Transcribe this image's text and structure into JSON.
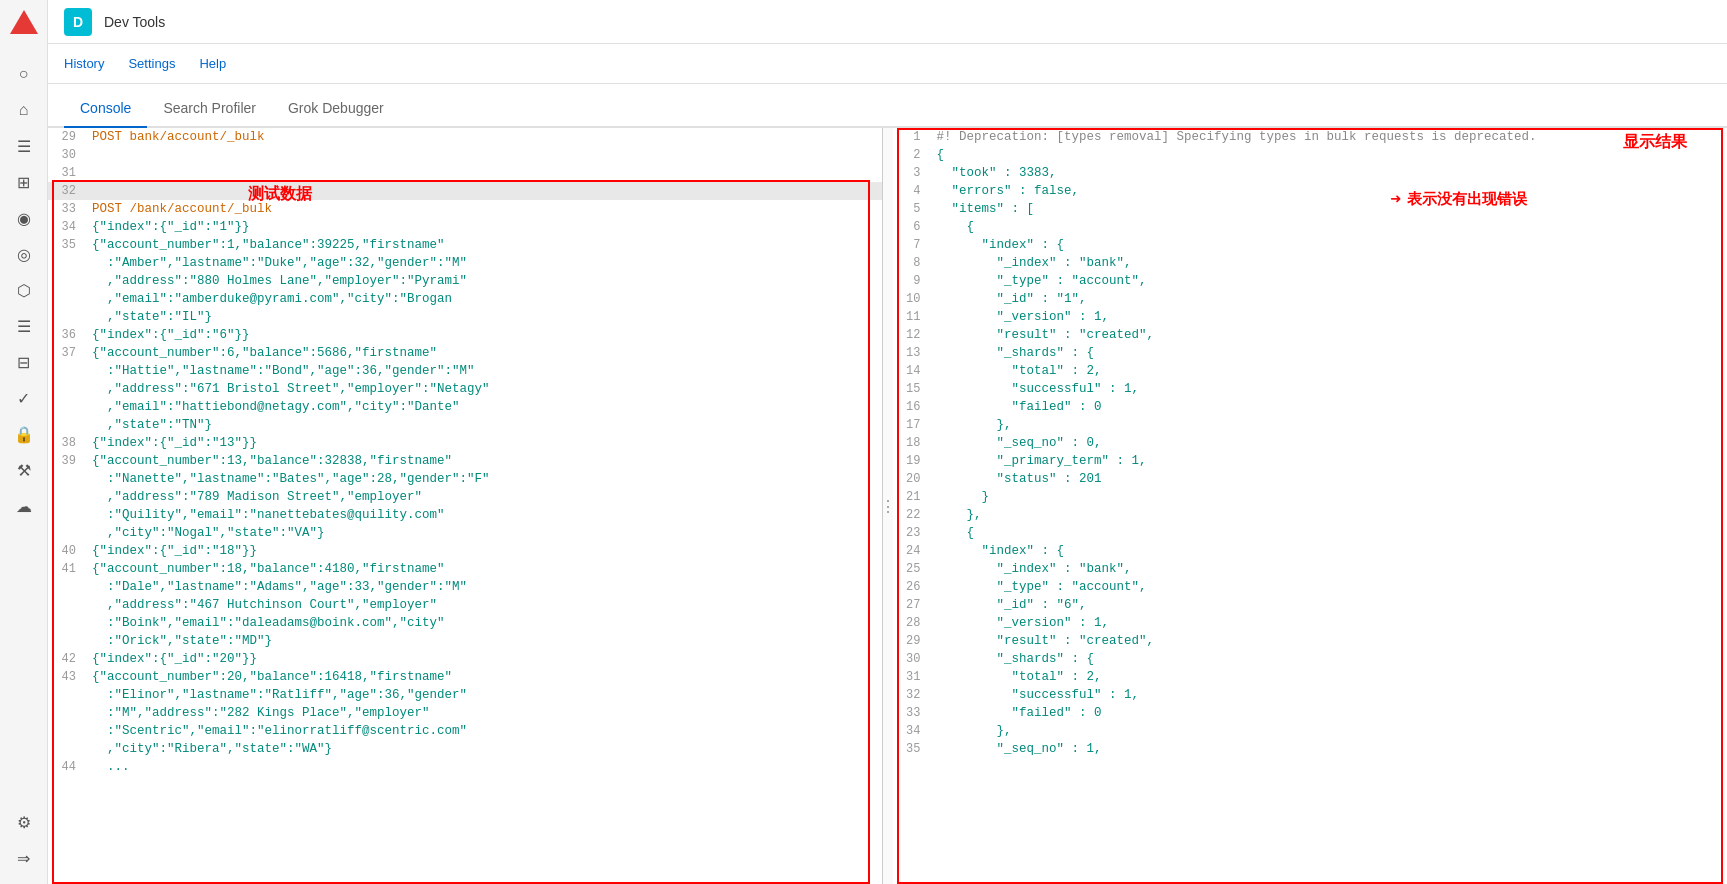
{
  "app": {
    "icon_label": "D",
    "title": "Dev Tools"
  },
  "nav": {
    "links": [
      "History",
      "Settings",
      "Help"
    ]
  },
  "tabs": {
    "items": [
      "Console",
      "Search Profiler",
      "Grok Debugger"
    ],
    "active": 0
  },
  "annotations": {
    "test_data_label": "测试数据",
    "result_label": "显示结果",
    "no_error_label": "表示没有出现错误"
  },
  "left_code": [
    {
      "num": "29",
      "content": "POST bank/account/_bulk",
      "class": "method"
    },
    {
      "num": "30",
      "content": ""
    },
    {
      "num": "31",
      "content": ""
    },
    {
      "num": "32",
      "content": "",
      "highlight": true
    },
    {
      "num": "33",
      "content": "POST /bank/account/_bulk"
    },
    {
      "num": "34",
      "content": "{\"index\":{\"_id\":\"1\"}}"
    },
    {
      "num": "35",
      "content": "{\"account_number\":1,\"balance\":39225,\"firstname\""
    },
    {
      "num": "",
      "content": "  :\"Amber\",\"lastname\":\"Duke\",\"age\":32,\"gender\":\"M\""
    },
    {
      "num": "",
      "content": "  ,\"address\":\"880 Holmes Lane\",\"employer\":\"Pyrami\""
    },
    {
      "num": "",
      "content": "  ,\"email\":\"amberduke@pyrami.com\",\"city\":\"Brogan"
    },
    {
      "num": "",
      "content": "  ,\"state\":\"IL\"}"
    },
    {
      "num": "36",
      "content": "{\"index\":{\"_id\":\"6\"}}"
    },
    {
      "num": "37",
      "content": "{\"account_number\":6,\"balance\":5686,\"firstname\""
    },
    {
      "num": "",
      "content": "  :\"Hattie\",\"lastname\":\"Bond\",\"age\":36,\"gender\":\"M\""
    },
    {
      "num": "",
      "content": "  ,\"address\":\"671 Bristol Street\",\"employer\":\"Netagy\""
    },
    {
      "num": "",
      "content": "  ,\"email\":\"hattiebond@netagy.com\",\"city\":\"Dante\""
    },
    {
      "num": "",
      "content": "  ,\"state\":\"TN\"}"
    },
    {
      "num": "38",
      "content": "{\"index\":{\"_id\":\"13\"}}"
    },
    {
      "num": "39",
      "content": "{\"account_number\":13,\"balance\":32838,\"firstname\""
    },
    {
      "num": "",
      "content": "  :\"Nanette\",\"lastname\":\"Bates\",\"age\":28,\"gender\":\"F\""
    },
    {
      "num": "",
      "content": "  ,\"address\":\"789 Madison Street\",\"employer\""
    },
    {
      "num": "",
      "content": "  :\"Quility\",\"email\":\"nanettebates@quility.com\""
    },
    {
      "num": "",
      "content": "  ,\"city\":\"Nogal\",\"state\":\"VA\"}"
    },
    {
      "num": "40",
      "content": "{\"index\":{\"_id\":\"18\"}}"
    },
    {
      "num": "41",
      "content": "{\"account_number\":18,\"balance\":4180,\"firstname\""
    },
    {
      "num": "",
      "content": "  :\"Dale\",\"lastname\":\"Adams\",\"age\":33,\"gender\":\"M\""
    },
    {
      "num": "",
      "content": "  ,\"address\":\"467 Hutchinson Court\",\"employer\""
    },
    {
      "num": "",
      "content": "  :\"Boink\",\"email\":\"daleadams@boink.com\",\"city\""
    },
    {
      "num": "",
      "content": "  :\"Orick\",\"state\":\"MD\"}"
    },
    {
      "num": "42",
      "content": "{\"index\":{\"_id\":\"20\"}}"
    },
    {
      "num": "43",
      "content": "{\"account_number\":20,\"balance\":16418,\"firstname\""
    },
    {
      "num": "",
      "content": "  :\"Elinor\",\"lastname\":\"Ratliff\",\"age\":36,\"gender\""
    },
    {
      "num": "",
      "content": "  :\"M\",\"address\":\"282 Kings Place\",\"employer\""
    },
    {
      "num": "",
      "content": "  :\"Scentric\",\"email\":\"elinorratliff@scentric.com\""
    },
    {
      "num": "",
      "content": "  ,\"city\":\"Ribera\",\"state\":\"WA\"}"
    },
    {
      "num": "44",
      "content": "  ..."
    }
  ],
  "right_code": [
    {
      "num": "1",
      "content": "#! Deprecation: [types removal] Specifying types in bulk requests is deprecated."
    },
    {
      "num": "2",
      "content": "{"
    },
    {
      "num": "3",
      "content": "  \"took\" : 3383,"
    },
    {
      "num": "4",
      "content": "  \"errors\" : false,"
    },
    {
      "num": "5",
      "content": "  \"items\" : ["
    },
    {
      "num": "6",
      "content": "    {"
    },
    {
      "num": "7",
      "content": "      \"index\" : {"
    },
    {
      "num": "8",
      "content": "        \"_index\" : \"bank\","
    },
    {
      "num": "9",
      "content": "        \"_type\" : \"account\","
    },
    {
      "num": "10",
      "content": "        \"_id\" : \"1\","
    },
    {
      "num": "11",
      "content": "        \"_version\" : 1,"
    },
    {
      "num": "12",
      "content": "        \"result\" : \"created\","
    },
    {
      "num": "13",
      "content": "        \"_shards\" : {"
    },
    {
      "num": "14",
      "content": "          \"total\" : 2,"
    },
    {
      "num": "15",
      "content": "          \"successful\" : 1,"
    },
    {
      "num": "16",
      "content": "          \"failed\" : 0"
    },
    {
      "num": "17",
      "content": "        },"
    },
    {
      "num": "18",
      "content": "        \"_seq_no\" : 0,"
    },
    {
      "num": "19",
      "content": "        \"_primary_term\" : 1,"
    },
    {
      "num": "20",
      "content": "        \"status\" : 201"
    },
    {
      "num": "21",
      "content": "      }"
    },
    {
      "num": "22",
      "content": "    },"
    },
    {
      "num": "23",
      "content": "    {"
    },
    {
      "num": "24",
      "content": "      \"index\" : {"
    },
    {
      "num": "25",
      "content": "        \"_index\" : \"bank\","
    },
    {
      "num": "26",
      "content": "        \"_type\" : \"account\","
    },
    {
      "num": "27",
      "content": "        \"_id\" : \"6\","
    },
    {
      "num": "28",
      "content": "        \"_version\" : 1,"
    },
    {
      "num": "29",
      "content": "        \"result\" : \"created\","
    },
    {
      "num": "30",
      "content": "        \"_shards\" : {"
    },
    {
      "num": "31",
      "content": "          \"total\" : 2,"
    },
    {
      "num": "32",
      "content": "          \"successful\" : 1,"
    },
    {
      "num": "33",
      "content": "          \"failed\" : 0"
    },
    {
      "num": "34",
      "content": "        },"
    },
    {
      "num": "35",
      "content": "        \"_seq_no\" : 1,"
    }
  ],
  "sidebar_icons": [
    {
      "name": "circle-icon",
      "symbol": "○"
    },
    {
      "name": "home-icon",
      "symbol": "⌂"
    },
    {
      "name": "list-icon",
      "symbol": "≡"
    },
    {
      "name": "grid-icon",
      "symbol": "⊞"
    },
    {
      "name": "person-icon",
      "symbol": "👤"
    },
    {
      "name": "target-icon",
      "symbol": "◎"
    },
    {
      "name": "shield-icon",
      "symbol": "🛡"
    },
    {
      "name": "document-icon",
      "symbol": "📄"
    },
    {
      "name": "stack-icon",
      "symbol": "⊟"
    },
    {
      "name": "check-icon",
      "symbol": "✓"
    },
    {
      "name": "lock-icon",
      "symbol": "🔒"
    },
    {
      "name": "tool-icon",
      "symbol": "⚙"
    },
    {
      "name": "cloud-icon",
      "symbol": "☁"
    },
    {
      "name": "gear-icon",
      "symbol": "⚙"
    },
    {
      "name": "arrow-icon",
      "symbol": "⇒"
    }
  ]
}
